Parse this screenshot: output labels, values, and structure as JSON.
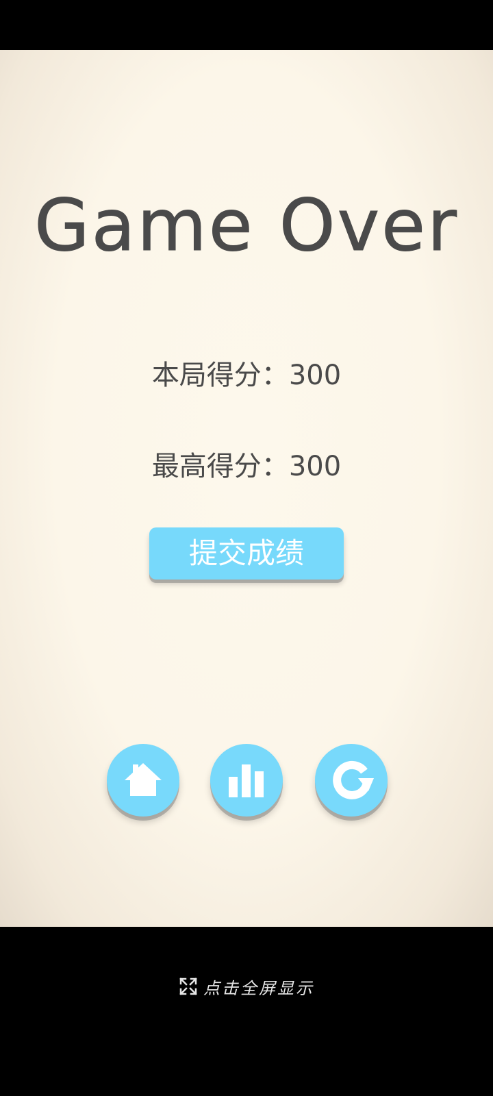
{
  "game": {
    "title": "Game Over",
    "current_score_label": "本局得分：",
    "current_score_value": "300",
    "best_score_label": "最高得分：",
    "best_score_value": "300",
    "submit_label": "提交成绩"
  },
  "buttons": {
    "home_icon": "home-icon",
    "rank_icon": "bar-chart-icon",
    "restart_icon": "refresh-icon"
  },
  "footer": {
    "fullscreen_label": "点击全屏显示",
    "fullscreen_icon": "expand-icon"
  },
  "colors": {
    "accent": "#78d9fb",
    "text": "#4a4a4a",
    "background": "#fcf6e9"
  }
}
